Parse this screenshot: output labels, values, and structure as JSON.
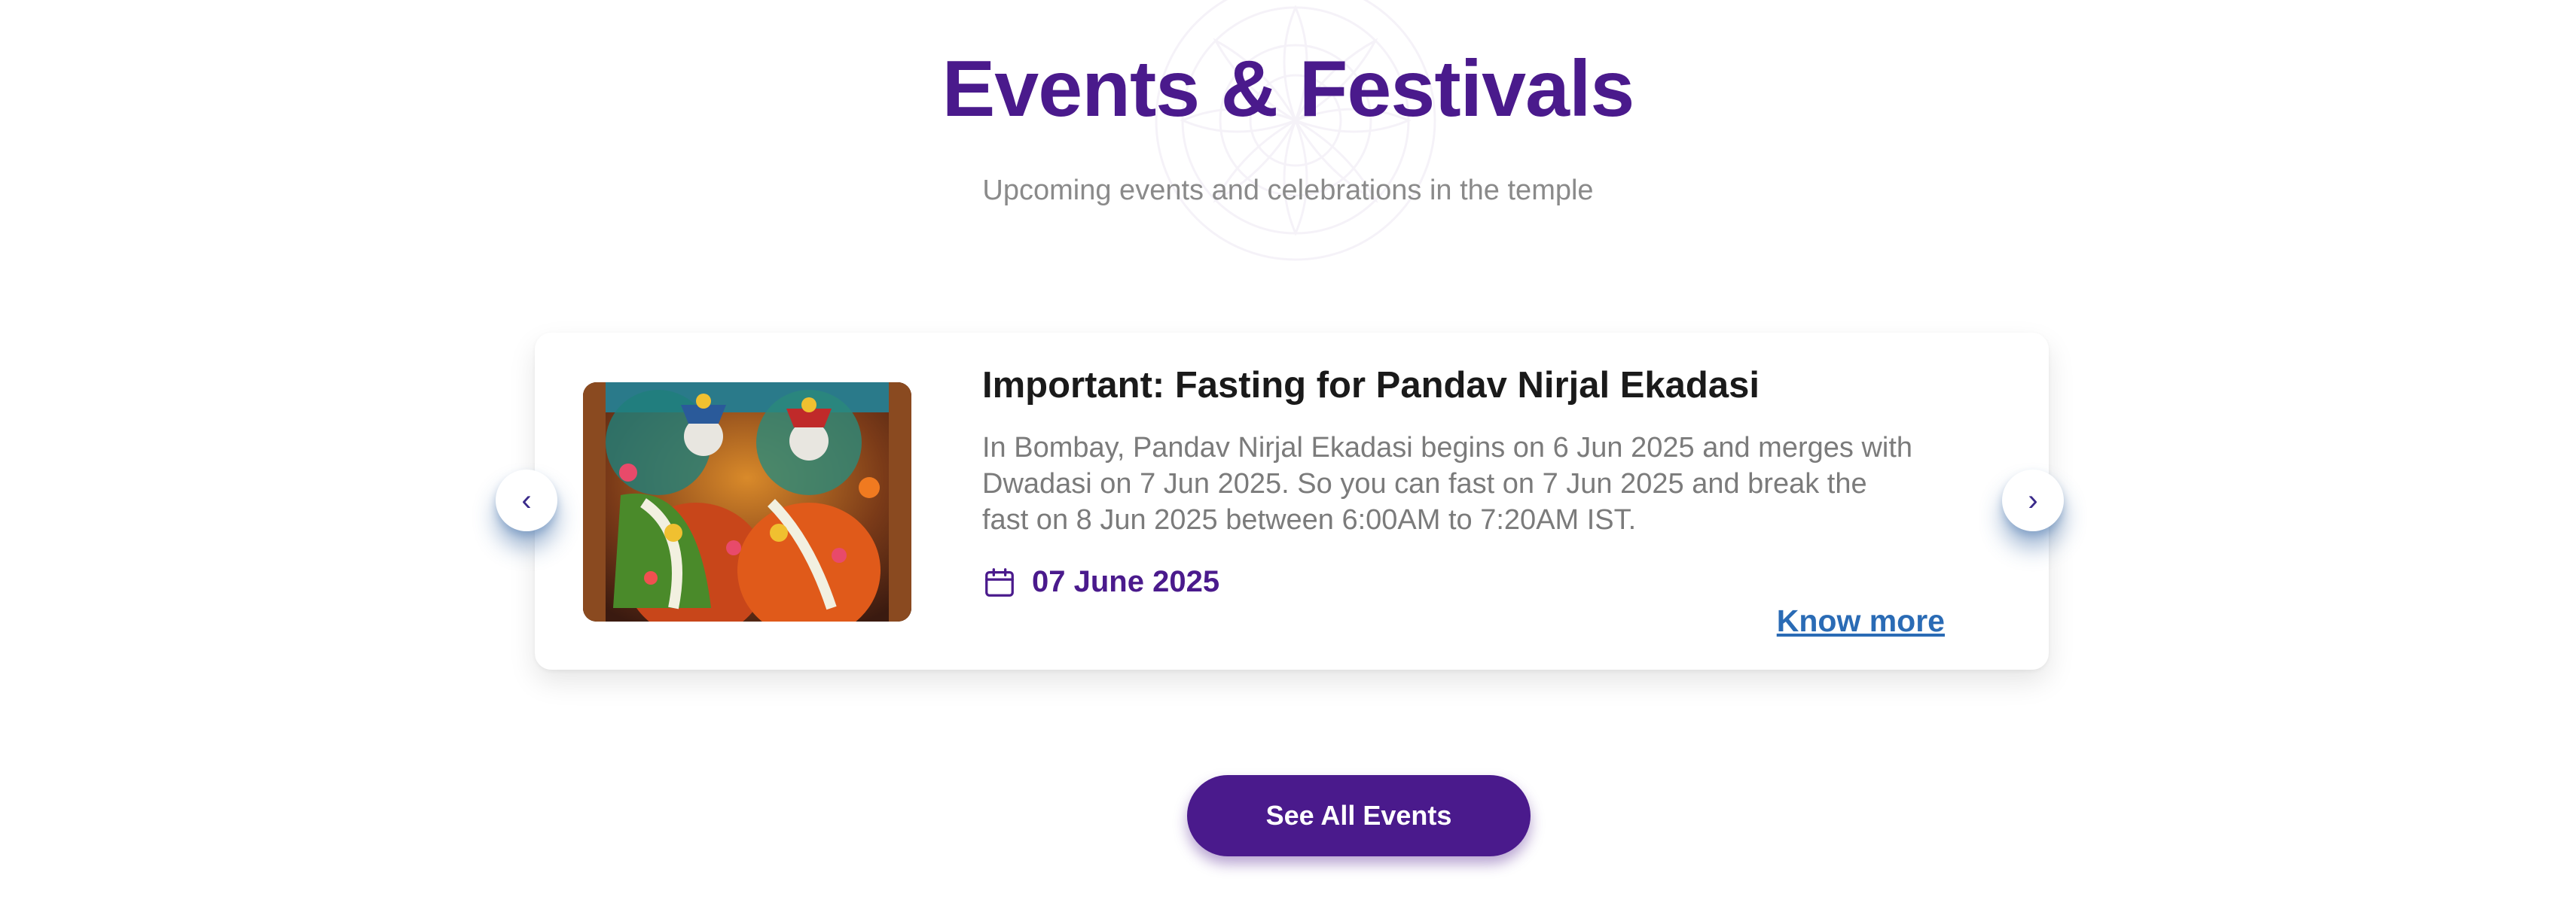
{
  "section": {
    "title": "Events & Festivals",
    "subtitle": "Upcoming events and celebrations in the temple"
  },
  "event": {
    "title": "Important: Fasting for Pandav Nirjal Ekadasi",
    "description": "In Bombay, Pandav Nirjal Ekadasi begins on 6 Jun 2025 and merges with Dwadasi on 7 Jun 2025. So you can fast on 7 Jun 2025 and break the fast on 8 Jun 2025 between 6:00AM to 7:20AM IST.",
    "date": "07 June 2025",
    "know_more_label": "Know more",
    "date_icon": "calendar-icon"
  },
  "carousel": {
    "prev_label": "‹",
    "next_label": "›",
    "prev_icon": "chevron-left-icon",
    "next_icon": "chevron-right-icon"
  },
  "actions": {
    "see_all_label": "See All Events"
  },
  "colors": {
    "primary": "#4a1a8c",
    "link": "#2a6bb5",
    "muted_text": "#7b7b7b",
    "heading_text": "#1a1a1a"
  }
}
